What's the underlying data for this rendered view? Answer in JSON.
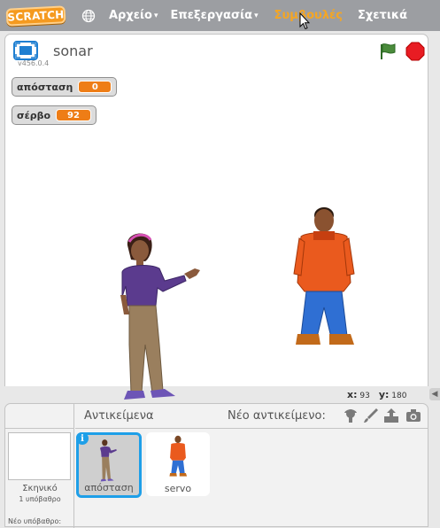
{
  "menubar": {
    "logo": "SCRATCH",
    "items": [
      {
        "label": "Αρχείο",
        "has_caret": true
      },
      {
        "label": "Επεξεργασία",
        "has_caret": true
      },
      {
        "label": "Συμβουλές",
        "has_caret": false
      },
      {
        "label": "Σχετικά",
        "has_caret": false
      }
    ],
    "caret": "▾",
    "icons": [
      "globe-icon",
      "mouse-cursor"
    ]
  },
  "stage_header": {
    "project_title": "sonar",
    "version": "v456.0.4",
    "icons": [
      "fullscreen-icon",
      "green-flag-icon",
      "stop-icon"
    ]
  },
  "monitors": [
    {
      "label": "απόσταση",
      "value": "0"
    },
    {
      "label": "σέρβο",
      "value": "92"
    }
  ],
  "coords": {
    "x_label": "x:",
    "x_value": "93",
    "y_label": "y:",
    "y_value": "180"
  },
  "scroll_arrow": "◀",
  "sprite_panel": {
    "stage_name": "Σκηνικό",
    "stage_sub": "1 υπόβαθρο",
    "new_backdrop": "Νέο υπόβαθρο:",
    "title": "Αντικείμενα",
    "new_sprite_label": "Νέο αντικείμενο:",
    "tools": [
      "sprite-library-icon",
      "paint-brush-icon",
      "upload-icon",
      "camera-icon"
    ],
    "info_badge": "i",
    "sprites": [
      {
        "name": "απόσταση",
        "selected": true
      },
      {
        "name": "servo",
        "selected": false
      }
    ]
  },
  "colors": {
    "menubar": "#9c9ea2",
    "logo": "#f59a1f",
    "active_menu": "#f5a623",
    "monitor_value": "#ee7d16",
    "selection": "#1e9fe8",
    "stop": "#e81c23",
    "flag": "#4a8b3b"
  }
}
